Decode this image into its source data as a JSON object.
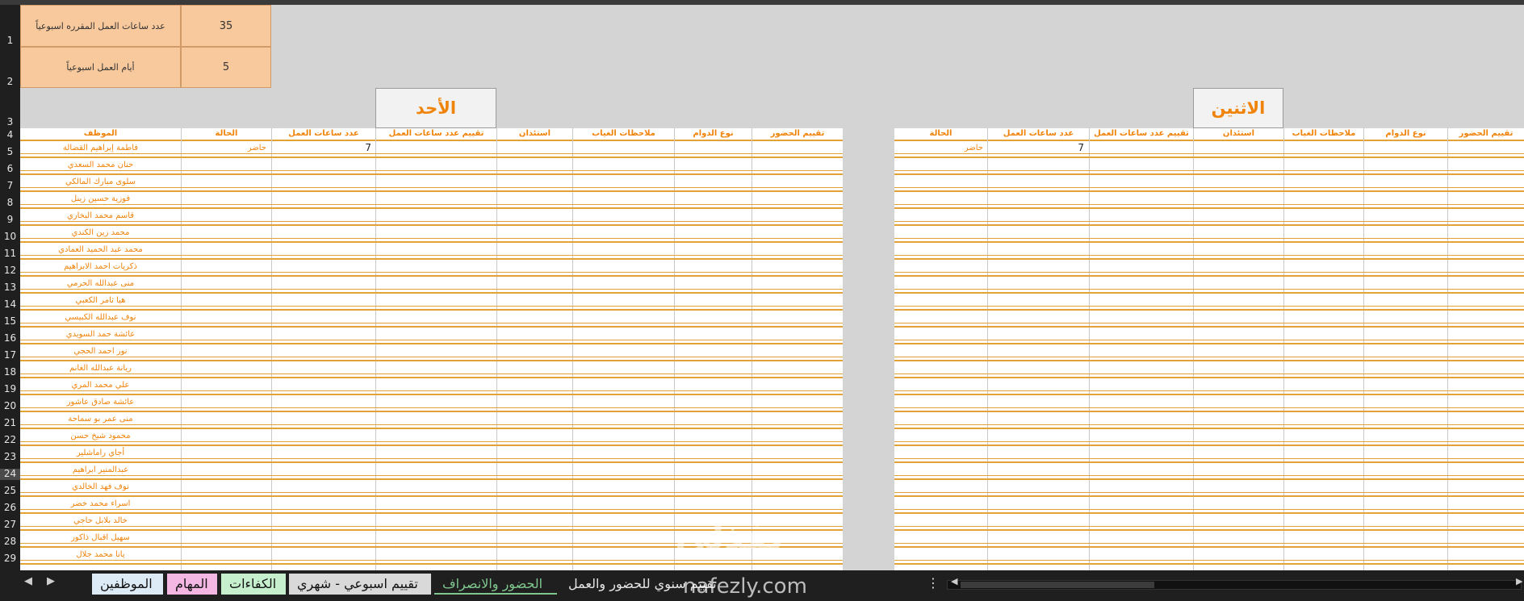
{
  "settings": {
    "weekly_hours_label": "عدد ساعات العمل المقرره اسبوعياً",
    "weekly_hours_value": "35",
    "work_days_label": "أيام العمل اسبوعياً",
    "work_days_value": "5"
  },
  "days": {
    "sunday": "الأحد",
    "monday": "الاثنين"
  },
  "columns": {
    "employee": "الموظف",
    "status": "الحالة",
    "work_hours": "عدد ساعات العمل",
    "hours_rating": "تقييم عدد ساعات العمل",
    "permission": "استئذان",
    "absence_notes": "ملاحظات الغياب",
    "shift_type": "نوع الدوام",
    "attendance_rating": "تقييم الحضور"
  },
  "row_numbers": [
    "1",
    "2",
    "3",
    "4",
    "5",
    "6",
    "7",
    "8",
    "9",
    "10",
    "11",
    "12",
    "13",
    "14",
    "15",
    "16",
    "17",
    "18",
    "19",
    "20",
    "21",
    "22",
    "23",
    "24",
    "25",
    "26",
    "27",
    "28",
    "29"
  ],
  "selected_row": "24",
  "employees": [
    "فاطمة إبراهيم القضالة",
    "حنان محمد السعدي",
    "سلوى مبارك المالكي",
    "فوزية حسين زينل",
    "قاسم محمد البخاري",
    "محمد زين الكندي",
    "محمد عبد الحميد العمادي",
    "ذكريات احمد الابراهيم",
    "منى عبدالله الحرمي",
    "هيا ثامر الكعبي",
    "نوف عبدالله الكبيسي",
    "عائشة حمد السويدي",
    "نور احمد الحجي",
    "ريانة عبدالله الغانم",
    "علي محمد المري",
    "عائشة صادق عاشور",
    "منى عمر بو سماحة",
    "محمود شيخ حسن",
    "أجاي راماشلير",
    "عبدالمنير ابراهيم",
    "نوف فهد الخالدي",
    "اسراء محمد خضر",
    "خالد بلابل حاجي",
    "سهيل اقبال ذاكور",
    "يانا محمد جلال"
  ],
  "first_row": {
    "status": "حاضر",
    "hours": "7"
  },
  "tabs": {
    "employees": "الموظفين",
    "tasks": "المهام",
    "competencies": "الكفاءات",
    "weekly_monthly": "تقييم اسبوعي - شهري",
    "attendance": "الحضور والانصراف",
    "annual": "تقييم سنوي للحضور والعمل"
  },
  "watermark": {
    "arabic": "نفذلي",
    "latin": "nafezly.com"
  },
  "colors": {
    "accent_orange": "#f0830a",
    "info_fill": "#f8c99c",
    "tab_employees": "#ddebf7",
    "tab_tasks": "#f4b6e3",
    "tab_competencies": "#c6efce",
    "tab_weekly": "#d9d9d9",
    "tab_active_text": "#7fc78f"
  }
}
